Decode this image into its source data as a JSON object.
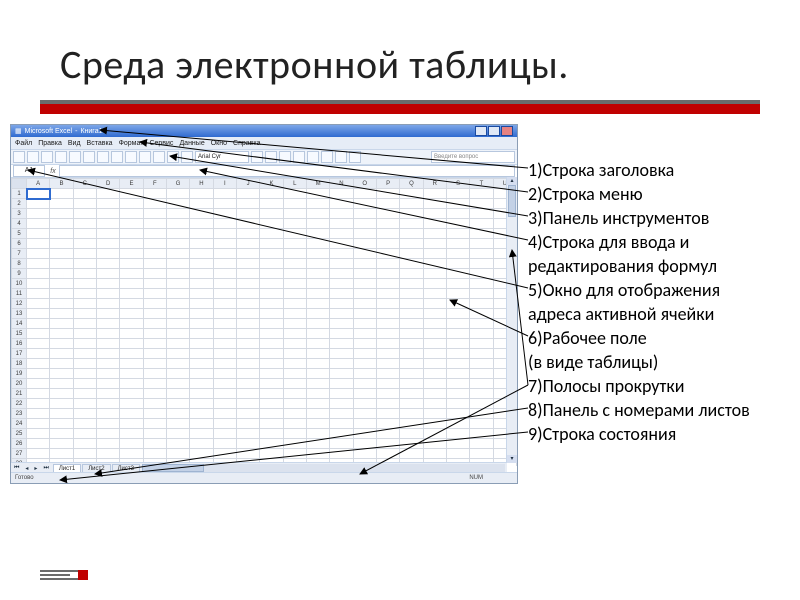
{
  "slide": {
    "title": "Среда электронной таблицы."
  },
  "excel": {
    "title_app": "Microsoft Excel",
    "title_doc": "Книга1",
    "menu": [
      "Файл",
      "Правка",
      "Вид",
      "Вставка",
      "Формат",
      "Сервис",
      "Данные",
      "Окно",
      "Справка"
    ],
    "font_name": "Arial Cyr",
    "ask_hint": "Введите вопрос",
    "name_box": "A1",
    "fx": "fx",
    "columns": [
      "A",
      "B",
      "C",
      "D",
      "E",
      "F",
      "G",
      "H",
      "I",
      "J",
      "K",
      "L",
      "M",
      "N",
      "O",
      "P",
      "Q",
      "R",
      "S",
      "T",
      "U"
    ],
    "sheets": [
      "Лист1",
      "Лист2",
      "Лист3"
    ],
    "status_ready": "Готово",
    "status_num": "NUM"
  },
  "legend": {
    "l1": "1)Строка заголовка",
    "l2": "2)Строка меню",
    "l3": "3)Панель инструментов",
    "l4a": "4)Строка для ввода и",
    "l4b": "редактирования формул",
    "l5a": "5)Окно для отображения",
    "l5b": "адреса активной ячейки",
    "l6a": "6)Рабочее поле",
    "l6b": "(в виде таблицы)",
    "l7": "7)Полосы прокрутки",
    "l8": "8)Панель с номерами листов",
    "l9": "9)Строка состояния"
  }
}
